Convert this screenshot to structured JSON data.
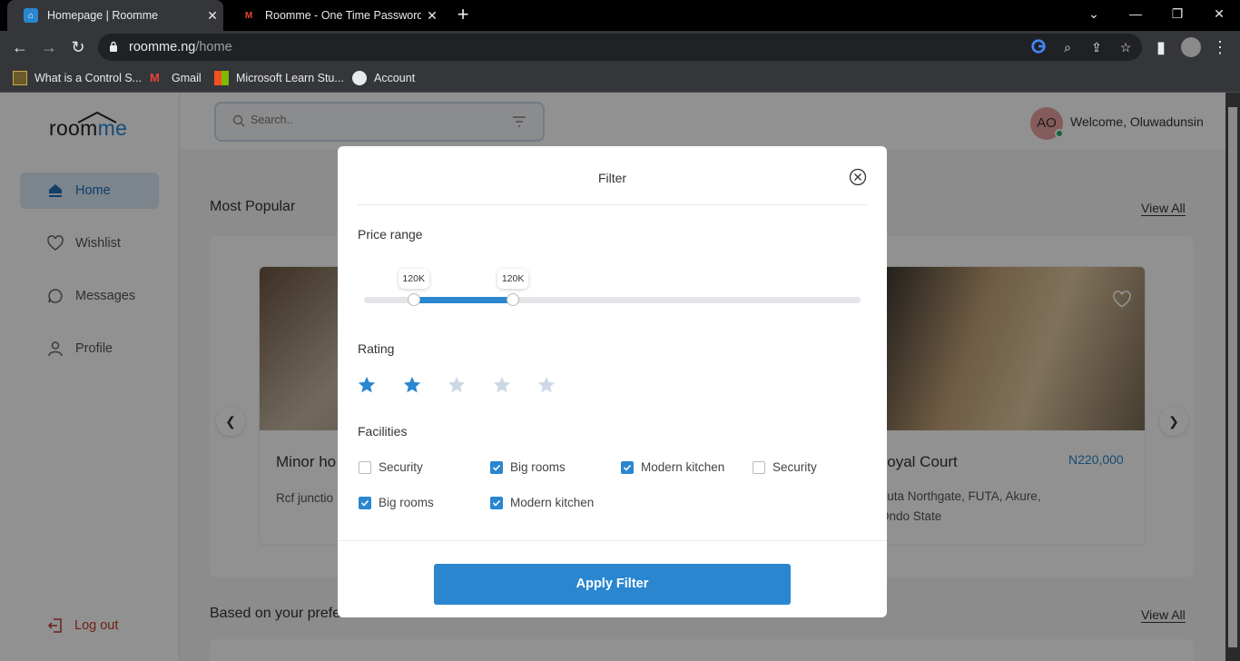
{
  "browser": {
    "tabs": [
      {
        "title": "Homepage | Roomme",
        "active": true
      },
      {
        "title": "Roomme - One Time Password -",
        "active": false
      }
    ],
    "url_host": "roomme.ng",
    "url_path": "/home",
    "bookmarks": [
      {
        "label": "What is a Control S...",
        "icon": "e4u-icon"
      },
      {
        "label": "Gmail",
        "icon": "gmail-icon"
      },
      {
        "label": "Microsoft Learn Stu...",
        "icon": "microsoft-icon"
      },
      {
        "label": "Account",
        "icon": "globe-icon"
      }
    ]
  },
  "app": {
    "logo_main": "room",
    "logo_accent": "me",
    "nav": [
      {
        "label": "Home",
        "icon": "home-icon",
        "active": true
      },
      {
        "label": "Wishlist",
        "icon": "heart-icon",
        "active": false
      },
      {
        "label": "Messages",
        "icon": "chat-icon",
        "active": false
      },
      {
        "label": "Profile",
        "icon": "user-icon",
        "active": false
      }
    ],
    "logout_label": "Log out",
    "search_placeholder": "Search..",
    "avatar_initials": "AO",
    "welcome": "Welcome, Oluwadunsin",
    "sections": {
      "popular_title": "Most Popular",
      "preference_title": "Based on your preference",
      "view_all": "View All"
    },
    "cards": [
      {
        "title": "Minor ho",
        "address": "Rcf junctio"
      },
      {
        "title": "Royal Court",
        "price": "N220,000",
        "address_line1": "Futa Northgate, FUTA, Akure,",
        "address_line2": "Ondo State"
      }
    ]
  },
  "filter_modal": {
    "title": "Filter",
    "price_label": "Price range",
    "price_min_label": "120K",
    "price_max_label": "120K",
    "price_min_fraction": 0.1,
    "price_max_fraction": 0.3,
    "rating_label": "Rating",
    "rating_value": 2,
    "rating_max": 5,
    "facilities_label": "Facilities",
    "facilities": [
      {
        "label": "Security",
        "checked": false
      },
      {
        "label": "Big rooms",
        "checked": true
      },
      {
        "label": "Modern kitchen",
        "checked": true
      },
      {
        "label": "Security",
        "checked": false
      },
      {
        "label": "Big rooms",
        "checked": true
      },
      {
        "label": "Modern kitchen",
        "checked": true
      }
    ],
    "apply_label": "Apply Filter"
  },
  "colors": {
    "accent": "#2a86cf",
    "star_inactive": "#cdd8e6",
    "logout": "#c0392b"
  }
}
